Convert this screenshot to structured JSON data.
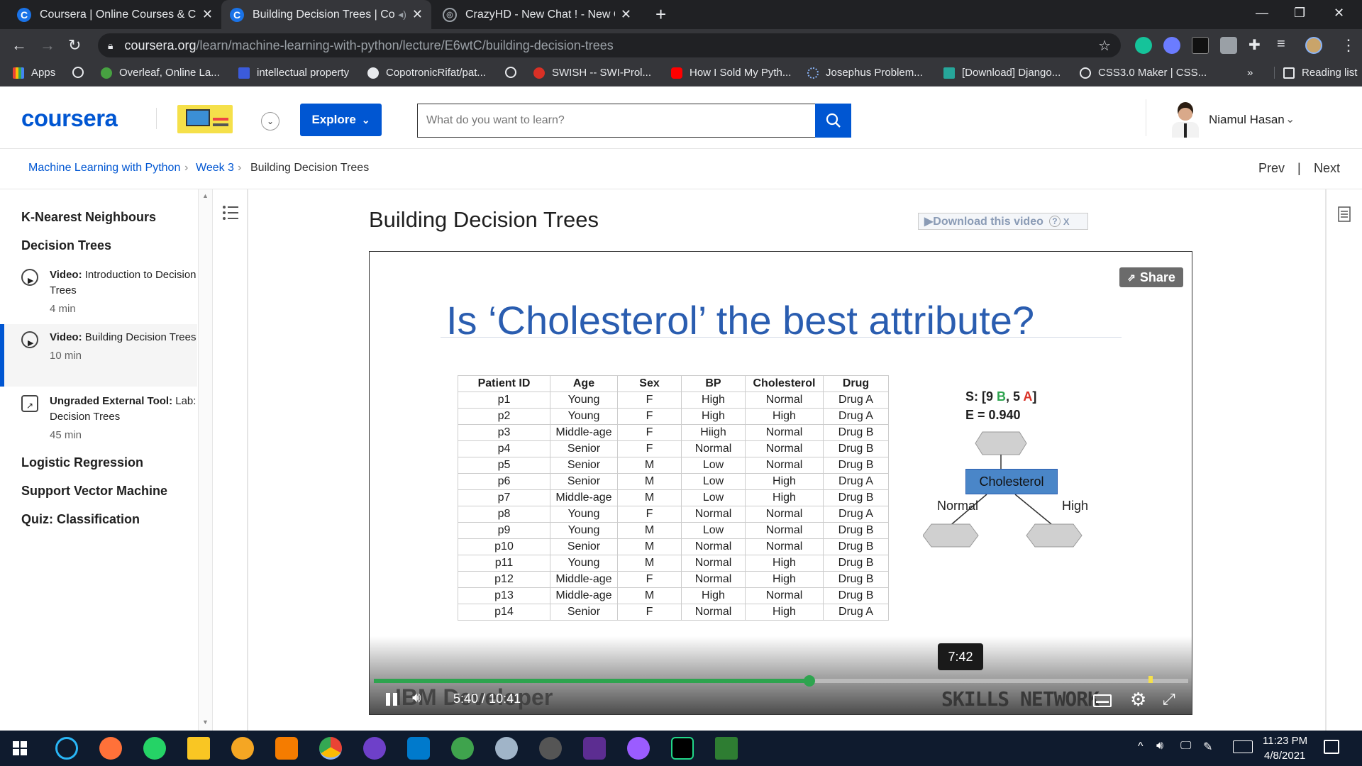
{
  "browser": {
    "tabs": [
      {
        "title": "Coursera | Online Courses & Cre",
        "favicon": "C"
      },
      {
        "title": "Building Decision Trees | Cou",
        "favicon": "C"
      },
      {
        "title": "CrazyHD - New Chat ! - New Cha",
        "favicon": "◎"
      }
    ],
    "new_tab": "+",
    "url_host": "coursera.org",
    "url_path": "/learn/machine-learning-with-python/lecture/E6wtC/building-decision-trees"
  },
  "bookmarks": {
    "items": [
      "Apps",
      "Overleaf, Online La...",
      "intellectual property",
      "CopotronicRifat/pat...",
      "SWISH -- SWI-Prol...",
      "How I Sold My Pyth...",
      "Josephus Problem...",
      "[Download] Django...",
      "CSS3.0 Maker | CSS..."
    ],
    "more": "»",
    "reading_list": "Reading list"
  },
  "header": {
    "logo": "coursera",
    "explore": "Explore",
    "search_placeholder": "What do you want to learn?",
    "user_name": "Niamul Hasan"
  },
  "breadcrumb": {
    "course": "Machine Learning with Python",
    "week": "Week 3",
    "current": "Building Decision Trees",
    "prev": "Prev",
    "next": "Next",
    "sep": "|"
  },
  "sidebar": {
    "sections": [
      "K-Nearest Neighbours",
      "Decision Trees",
      "Logistic Regression",
      "Support Vector Machine",
      "Quiz: Classification"
    ],
    "items": [
      {
        "kind": "Video:",
        "title": " Introduction to Decision Trees",
        "duration": "4 min"
      },
      {
        "kind": "Video:",
        "title": " Building Decision Trees",
        "duration": "10 min"
      },
      {
        "kind": "Ungraded External Tool:",
        "title": " Lab: Decision Trees",
        "duration": "45 min"
      }
    ]
  },
  "main": {
    "title": "Building Decision Trees",
    "download": "▶Download this video",
    "download_help": "?",
    "download_close": "X"
  },
  "video": {
    "share": "Share",
    "slide_title": "Is ‘Cholesterol’ the best attribute?",
    "table": {
      "headers": [
        "Patient ID",
        "Age",
        "Sex",
        "BP",
        "Cholesterol",
        "Drug"
      ],
      "rows": [
        [
          "p1",
          "Young",
          "F",
          "High",
          "Normal",
          "Drug A"
        ],
        [
          "p2",
          "Young",
          "F",
          "High",
          "High",
          "Drug A"
        ],
        [
          "p3",
          "Middle-age",
          "F",
          "Hiigh",
          "Normal",
          "Drug B"
        ],
        [
          "p4",
          "Senior",
          "F",
          "Normal",
          "Normal",
          "Drug B"
        ],
        [
          "p5",
          "Senior",
          "M",
          "Low",
          "Normal",
          "Drug B"
        ],
        [
          "p6",
          "Senior",
          "M",
          "Low",
          "High",
          "Drug A"
        ],
        [
          "p7",
          "Middle-age",
          "M",
          "Low",
          "High",
          "Drug B"
        ],
        [
          "p8",
          "Young",
          "F",
          "Normal",
          "Normal",
          "Drug A"
        ],
        [
          "p9",
          "Young",
          "M",
          "Low",
          "Normal",
          "Drug B"
        ],
        [
          "p10",
          "Senior",
          "M",
          "Normal",
          "Normal",
          "Drug B"
        ],
        [
          "p11",
          "Young",
          "M",
          "Normal",
          "High",
          "Drug B"
        ],
        [
          "p12",
          "Middle-age",
          "F",
          "Normal",
          "High",
          "Drug B"
        ],
        [
          "p13",
          "Middle-age",
          "M",
          "High",
          "Normal",
          "Drug B"
        ],
        [
          "p14",
          "Senior",
          "F",
          "Normal",
          "High",
          "Drug A"
        ]
      ]
    },
    "tree": {
      "s_prefix": "S: [9 ",
      "s_b": "B",
      "s_mid": ", 5 ",
      "s_a": "A",
      "s_suffix": "]",
      "entropy": "E = 0.940",
      "node": "Cholesterol",
      "left_branch": "Normal",
      "right_branch": "High"
    },
    "tooltip_time": "7:42",
    "current_time": "5:40",
    "time_sep": " / ",
    "duration": "10:41",
    "progress": 0.535,
    "brand_left": "IBM Developer",
    "brand_right": "SKILLS NETWORK"
  },
  "taskbar": {
    "time": "11:23 PM",
    "date": "4/8/2021"
  },
  "colors": {
    "coursera_blue": "#0056d2",
    "slide_blue": "#2a5db0",
    "node_blue": "#4a86c8",
    "progress_green": "#2ea44f"
  }
}
